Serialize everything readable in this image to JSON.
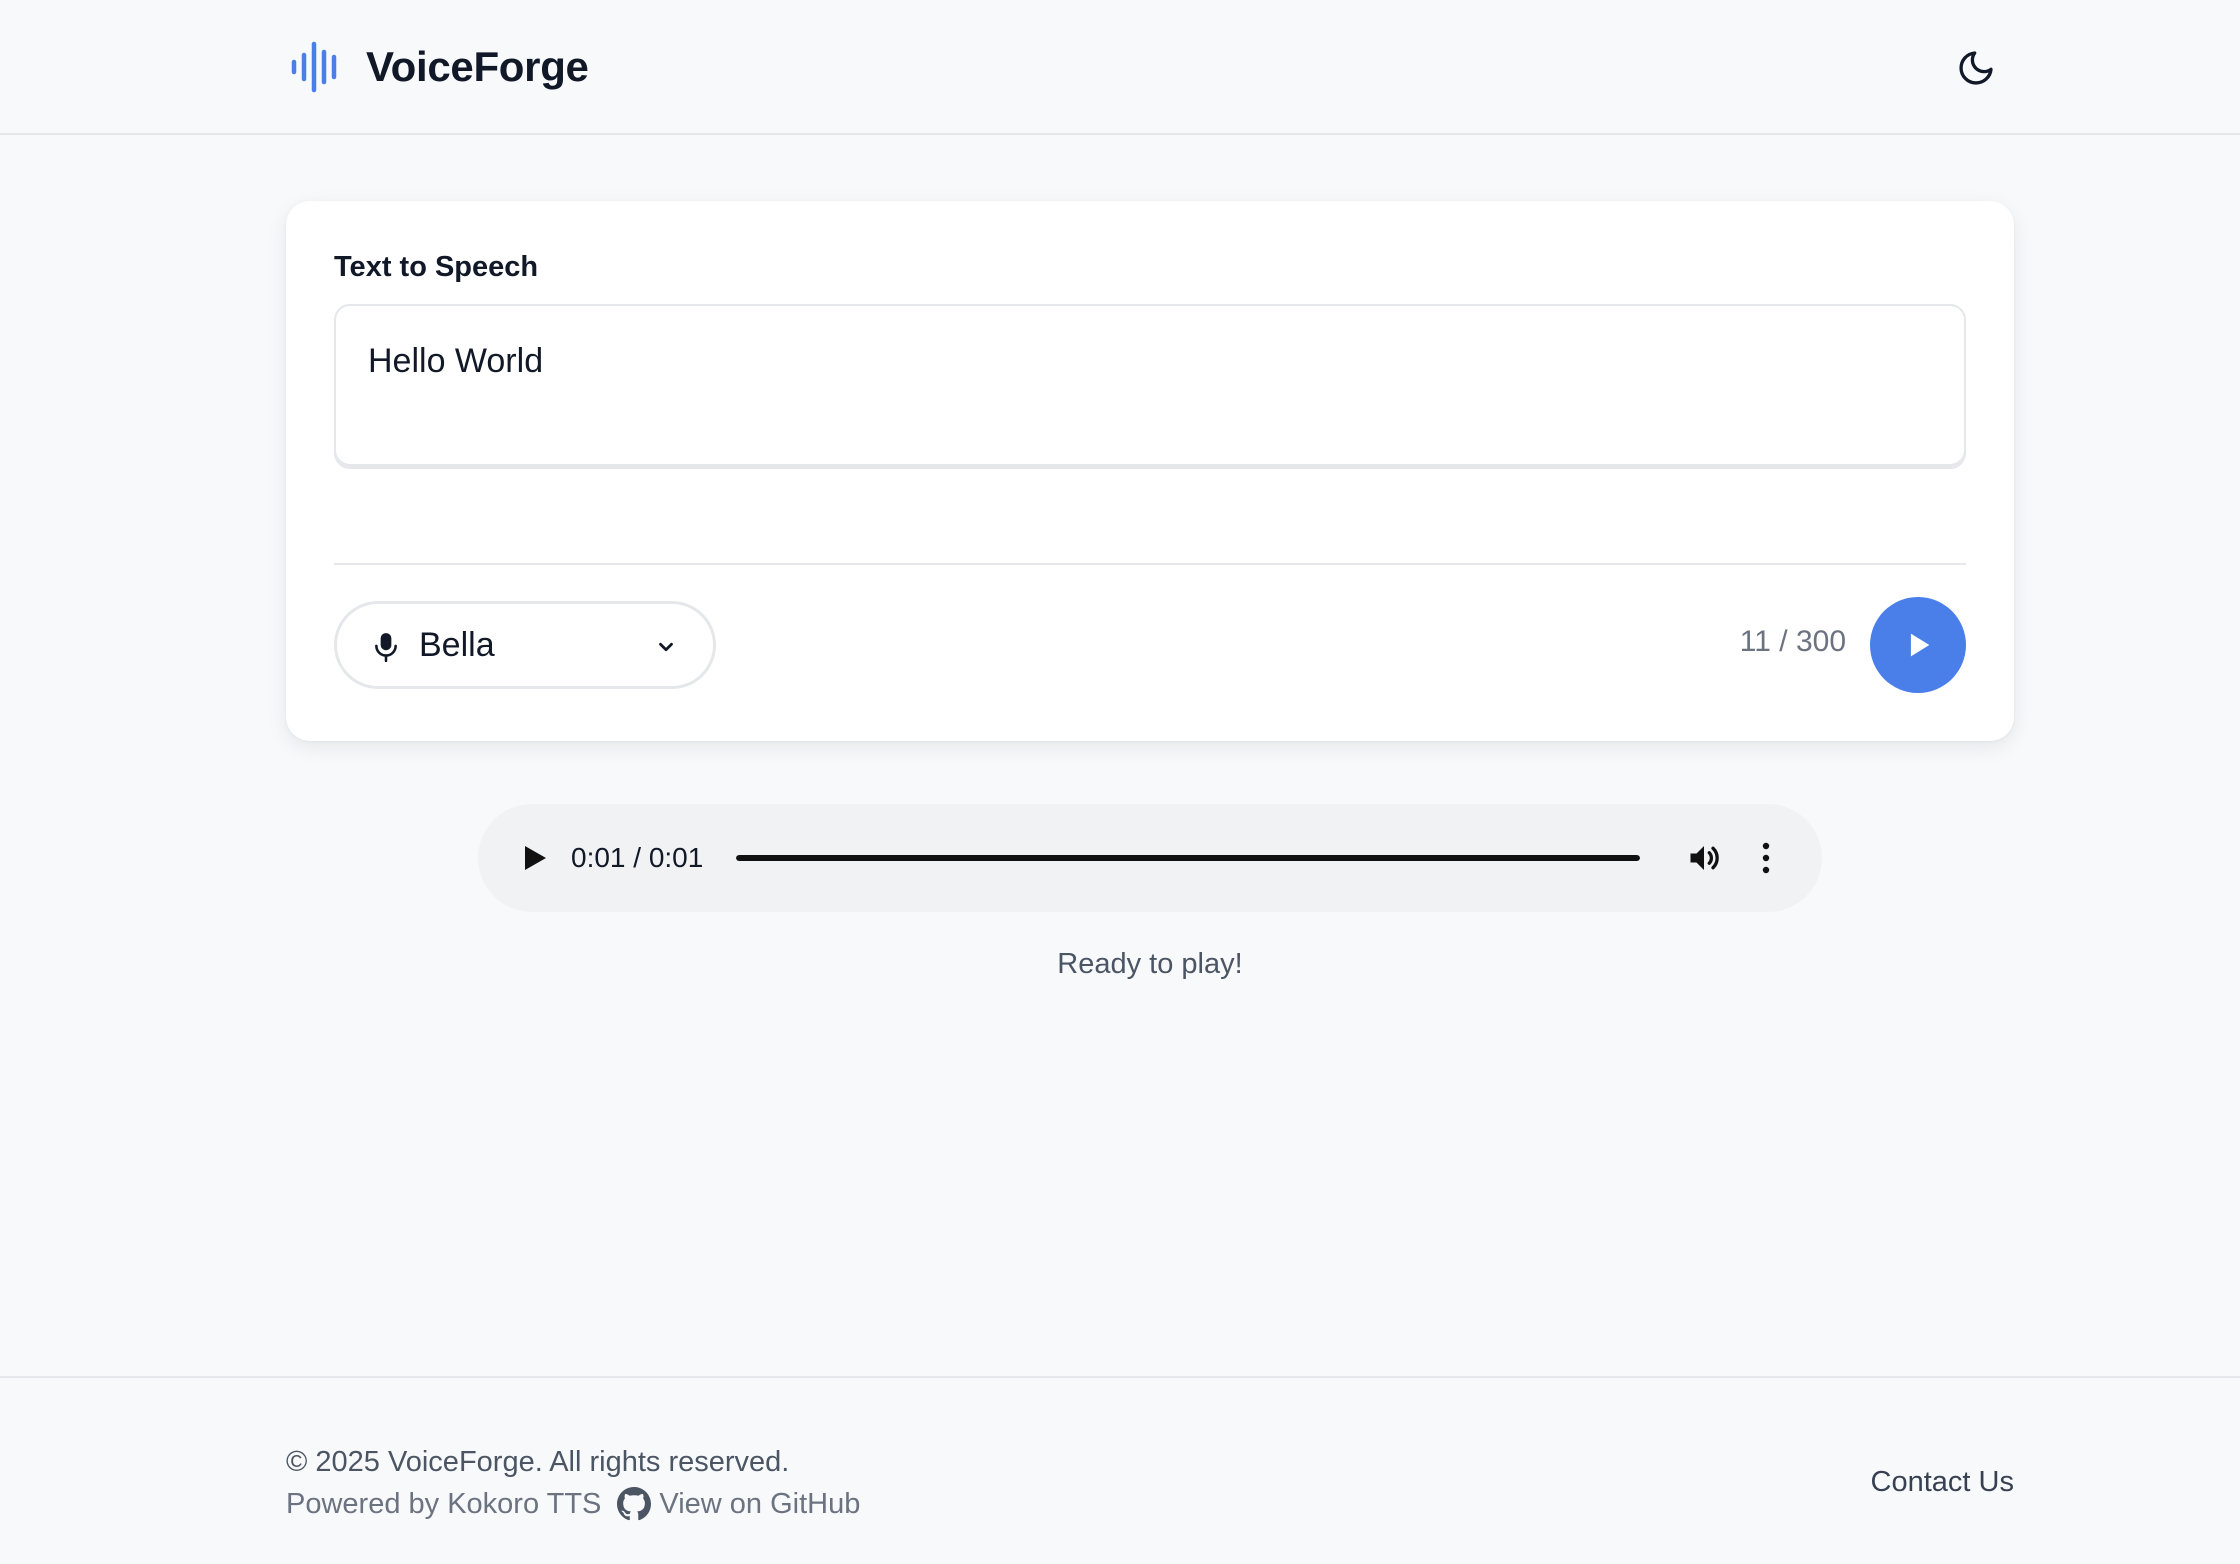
{
  "app": {
    "name": "VoiceForge",
    "brand_color": "#4a7fea"
  },
  "header": {
    "logo_icon": "waveform-icon",
    "theme_toggle_icon": "moon-icon"
  },
  "tts_card": {
    "label": "Text to Speech",
    "text_value": "Hello World",
    "voice": {
      "selected": "Bella",
      "icon": "microphone-icon",
      "dropdown_icon": "chevron-down-icon"
    },
    "char_count": "11 / 300",
    "generate_icon": "play-icon"
  },
  "audio_player": {
    "time": "0:01 / 0:01",
    "progress": 1.0,
    "icons": [
      "play-icon",
      "volume-icon",
      "more-vertical-icon"
    ]
  },
  "status": "Ready to play!",
  "footer": {
    "copyright": "© 2025 VoiceForge. All rights reserved.",
    "powered_by": "Powered by Kokoro TTS",
    "github_label": "View on GitHub",
    "github_icon": "github-icon",
    "contact": "Contact Us"
  }
}
